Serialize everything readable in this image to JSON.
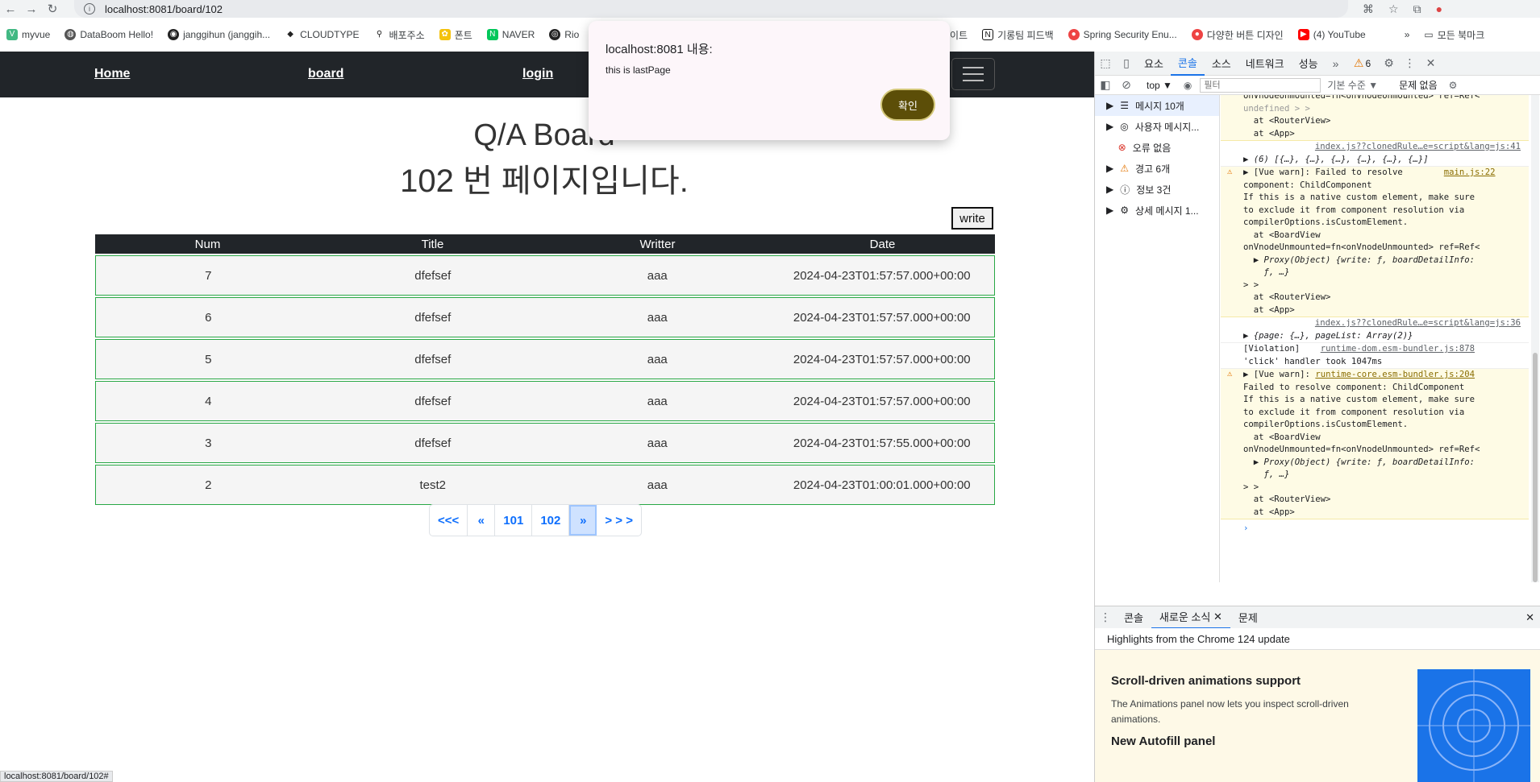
{
  "browser": {
    "url": "localhost:8081/board/102",
    "bookmarks": [
      "myvue",
      "DataBoom Hello!",
      "janggihun (janggih...",
      "CLOUDTYPE",
      "배포주소",
      "폰트",
      "NAVER",
      "Rio"
    ],
    "bookmarks_right": [
      "이트",
      "기롱팀 피드백",
      "Spring Security Enu...",
      "다양한 버튼 디자인",
      "(4) YouTube"
    ],
    "all_bookmarks": "모든 북마크",
    "status_url": "localhost:8081/board/102#"
  },
  "nav": {
    "home": "Home",
    "board": "board",
    "login": "login"
  },
  "board": {
    "title": "Q/A Boa...",
    "title_full": "Q/A Board",
    "subtitle": "102 번 페이지입니다.",
    "write_label": "write",
    "columns": [
      "Num",
      "Title",
      "Writter",
      "Date"
    ],
    "rows": [
      {
        "num": "7",
        "title": "dfefsef",
        "writer": "aaa",
        "date": "2024-04-23T01:57:57.000+00:00"
      },
      {
        "num": "6",
        "title": "dfefsef",
        "writer": "aaa",
        "date": "2024-04-23T01:57:57.000+00:00"
      },
      {
        "num": "5",
        "title": "dfefsef",
        "writer": "aaa",
        "date": "2024-04-23T01:57:57.000+00:00"
      },
      {
        "num": "4",
        "title": "dfefsef",
        "writer": "aaa",
        "date": "2024-04-23T01:57:57.000+00:00"
      },
      {
        "num": "3",
        "title": "dfefsef",
        "writer": "aaa",
        "date": "2024-04-23T01:57:55.000+00:00"
      },
      {
        "num": "2",
        "title": "test2",
        "writer": "aaa",
        "date": "2024-04-23T01:00:01.000+00:00"
      }
    ],
    "pagination": [
      "<<<",
      "«",
      "101",
      "102",
      "»",
      "> > >"
    ],
    "active_page": "»"
  },
  "alert": {
    "title": "localhost:8081 내용:",
    "message": "this is lastPage",
    "ok_label": "확인"
  },
  "devtools": {
    "tabs": [
      "요소",
      "콘솔",
      "소스",
      "네트워크",
      "성능"
    ],
    "active_tab": "콘솔",
    "warning_count": "6",
    "context": "top",
    "filter_placeholder": "필터",
    "level": "기본 수준",
    "issues": "문제 없음",
    "sidebar": [
      "메시지 10개",
      "사용자 메시지...",
      "오류 없음",
      "경고 6개",
      "정보 3건",
      "상세 메시지 1..."
    ],
    "console_lines": {
      "l1": "onVnodeUnmounted=fn<onVnodeUnmounted> ref=Ref<",
      "l2": "undefined > >",
      "l3": "  at <RouterView>",
      "l4": "  at <App>",
      "link1": "index.js??clonedRule…e=script&lang=js:41",
      "arr1": "▶ (6) [{…}, {…}, {…}, {…}, {…}, {…}]",
      "w1": "▶ [Vue warn]: Failed to resolve",
      "w1link": "main.js:22",
      "w1b": "component: ChildComponent",
      "w1c": "If this is a native custom element, make sure",
      "w1d": "to exclude it from component resolution via",
      "w1e": "compilerOptions.isCustomElement.",
      "w1f": "  at <BoardView",
      "w1g": "onVnodeUnmounted=fn<onVnodeUnmounted> ref=Ref<",
      "w1h": "  ▶ Proxy(Object) {write: ƒ, boardDetailInfo:",
      "w1i": "    ƒ, …}",
      "w1j": "> >",
      "w1k": "  at <RouterView>",
      "w1l": "  at <App>",
      "link2": "index.js??clonedRule…e=script&lang=js:36",
      "obj2": "▶ {page: {…}, pageList: Array(2)}",
      "viol": "[Violation]",
      "viollink": "runtime-dom.esm-bundler.js:878",
      "viol2": "'click' handler took 1047ms",
      "w2": "▶ [Vue warn]:",
      "w2link": "runtime-core.esm-bundler.js:204",
      "w2b": "Failed to resolve component: ChildComponent",
      "w2c": "If this is a native custom element, make sure",
      "w2d": "to exclude it from component resolution via",
      "w2e": "compilerOptions.isCustomElement.",
      "w2f": "  at <BoardView",
      "w2g": "onVnodeUnmounted=fn<onVnodeUnmounted> ref=Ref<",
      "w2h": "  ▶ Proxy(Object) {write: ƒ, boardDetailInfo:",
      "w2i": "    ƒ, …}",
      "w2j": "> >",
      "w2k": "  at <RouterView>",
      "w2l": "  at <App>",
      "prompt": "›"
    },
    "drawer_tabs": [
      "콘솔",
      "새로운 소식",
      "문제"
    ],
    "whats_new_header": "Highlights from the Chrome 124 update",
    "news1_title": "Scroll-driven animations support",
    "news1_body": "The Animations panel now lets you inspect scroll-driven animations.",
    "news2_title": "New Autofill panel"
  }
}
